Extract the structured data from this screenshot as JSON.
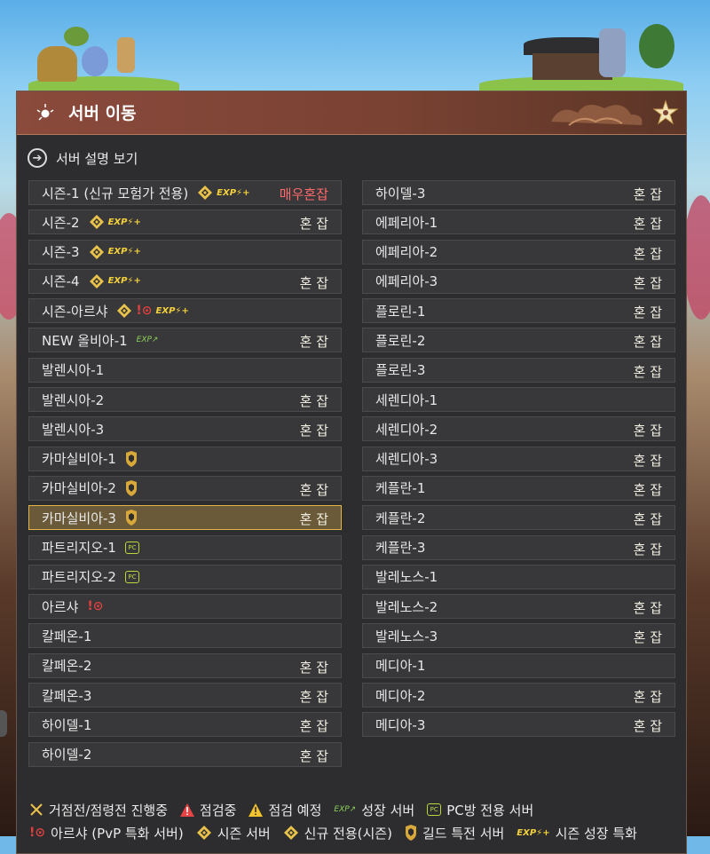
{
  "window": {
    "title": "서버 이동",
    "info_link": "서버 설명 보기"
  },
  "servers_left": [
    {
      "name": "시즌-1 (신규 모험가 전용)",
      "icons": [
        "season",
        "exp-boost"
      ],
      "status": "매우혼잡",
      "hot": true
    },
    {
      "name": "시즌-2",
      "icons": [
        "season",
        "exp-boost"
      ],
      "status": "혼 잡"
    },
    {
      "name": "시즌-3",
      "icons": [
        "season",
        "exp-boost"
      ],
      "status": ""
    },
    {
      "name": "시즌-4",
      "icons": [
        "season",
        "exp-boost"
      ],
      "status": "혼 잡"
    },
    {
      "name": "시즌-아르샤",
      "icons": [
        "season",
        "pvp",
        "exp-boost"
      ],
      "status": ""
    },
    {
      "name": "NEW 올비아-1",
      "icons": [
        "growth"
      ],
      "status": "혼 잡"
    },
    {
      "name": "발렌시아-1",
      "icons": [],
      "status": ""
    },
    {
      "name": "발렌시아-2",
      "icons": [],
      "status": "혼 잡"
    },
    {
      "name": "발렌시아-3",
      "icons": [],
      "status": "혼 잡"
    },
    {
      "name": "카마실비아-1",
      "icons": [
        "guild"
      ],
      "status": ""
    },
    {
      "name": "카마실비아-2",
      "icons": [
        "guild"
      ],
      "status": "혼 잡"
    },
    {
      "name": "카마실비아-3",
      "icons": [
        "guild"
      ],
      "status": "혼 잡",
      "selected": true
    },
    {
      "name": "파트리지오-1",
      "icons": [
        "pc"
      ],
      "status": ""
    },
    {
      "name": "파트리지오-2",
      "icons": [
        "pc"
      ],
      "status": ""
    },
    {
      "name": "아르샤",
      "icons": [
        "pvp"
      ],
      "status": ""
    },
    {
      "name": "칼페온-1",
      "icons": [],
      "status": ""
    },
    {
      "name": "칼페온-2",
      "icons": [],
      "status": "혼 잡"
    },
    {
      "name": "칼페온-3",
      "icons": [],
      "status": "혼 잡"
    },
    {
      "name": "하이델-1",
      "icons": [],
      "status": "혼 잡"
    },
    {
      "name": "하이델-2",
      "icons": [],
      "status": "혼 잡"
    }
  ],
  "servers_right": [
    {
      "name": "하이델-3",
      "icons": [],
      "status": "혼 잡"
    },
    {
      "name": "에페리아-1",
      "icons": [],
      "status": "혼 잡"
    },
    {
      "name": "에페리아-2",
      "icons": [],
      "status": "혼 잡"
    },
    {
      "name": "에페리아-3",
      "icons": [],
      "status": "혼 잡"
    },
    {
      "name": "플로린-1",
      "icons": [],
      "status": "혼 잡"
    },
    {
      "name": "플로린-2",
      "icons": [],
      "status": "혼 잡"
    },
    {
      "name": "플로린-3",
      "icons": [],
      "status": "혼 잡"
    },
    {
      "name": "세렌디아-1",
      "icons": [],
      "status": ""
    },
    {
      "name": "세렌디아-2",
      "icons": [],
      "status": "혼 잡"
    },
    {
      "name": "세렌디아-3",
      "icons": [],
      "status": "혼 잡"
    },
    {
      "name": "케플란-1",
      "icons": [],
      "status": "혼 잡"
    },
    {
      "name": "케플란-2",
      "icons": [],
      "status": "혼 잡"
    },
    {
      "name": "케플란-3",
      "icons": [],
      "status": "혼 잡"
    },
    {
      "name": "발레노스-1",
      "icons": [],
      "status": ""
    },
    {
      "name": "발레노스-2",
      "icons": [],
      "status": "혼 잡"
    },
    {
      "name": "발레노스-3",
      "icons": [],
      "status": "혼 잡"
    },
    {
      "name": "메디아-1",
      "icons": [],
      "status": ""
    },
    {
      "name": "메디아-2",
      "icons": [],
      "status": "혼 잡"
    },
    {
      "name": "메디아-3",
      "icons": [],
      "status": "혼 잡"
    }
  ],
  "icon_text": {
    "exp": "EXP",
    "pc": "PC"
  },
  "legend": {
    "line1": [
      {
        "icon": "war-icon",
        "label": "거점전/점령전 진행중"
      },
      {
        "icon": "maintenance-icon",
        "label": "점검중"
      },
      {
        "icon": "maintenance-scheduled-icon",
        "label": "점검 예정"
      },
      {
        "icon": "growth-icon",
        "label": "성장 서버"
      },
      {
        "icon": "pc-icon",
        "label": "PC방 전용 서버"
      }
    ],
    "line2": [
      {
        "icon": "pvp-icon",
        "label": "아르샤 (PvP 특화 서버)"
      },
      {
        "icon": "season-icon",
        "label": "시즌 서버"
      },
      {
        "icon": "season-new-icon",
        "label": "신규 전용(시즌)"
      },
      {
        "icon": "guild-icon",
        "label": "길드 특전 서버"
      },
      {
        "icon": "exp-boost-icon",
        "label": "시즌 성장 특화"
      }
    ]
  },
  "colors": {
    "title_bar": "#7a4233",
    "accent_gold": "#e3b64a",
    "hot_status": "#ff6a6a",
    "growth_green": "#8bd35a"
  }
}
